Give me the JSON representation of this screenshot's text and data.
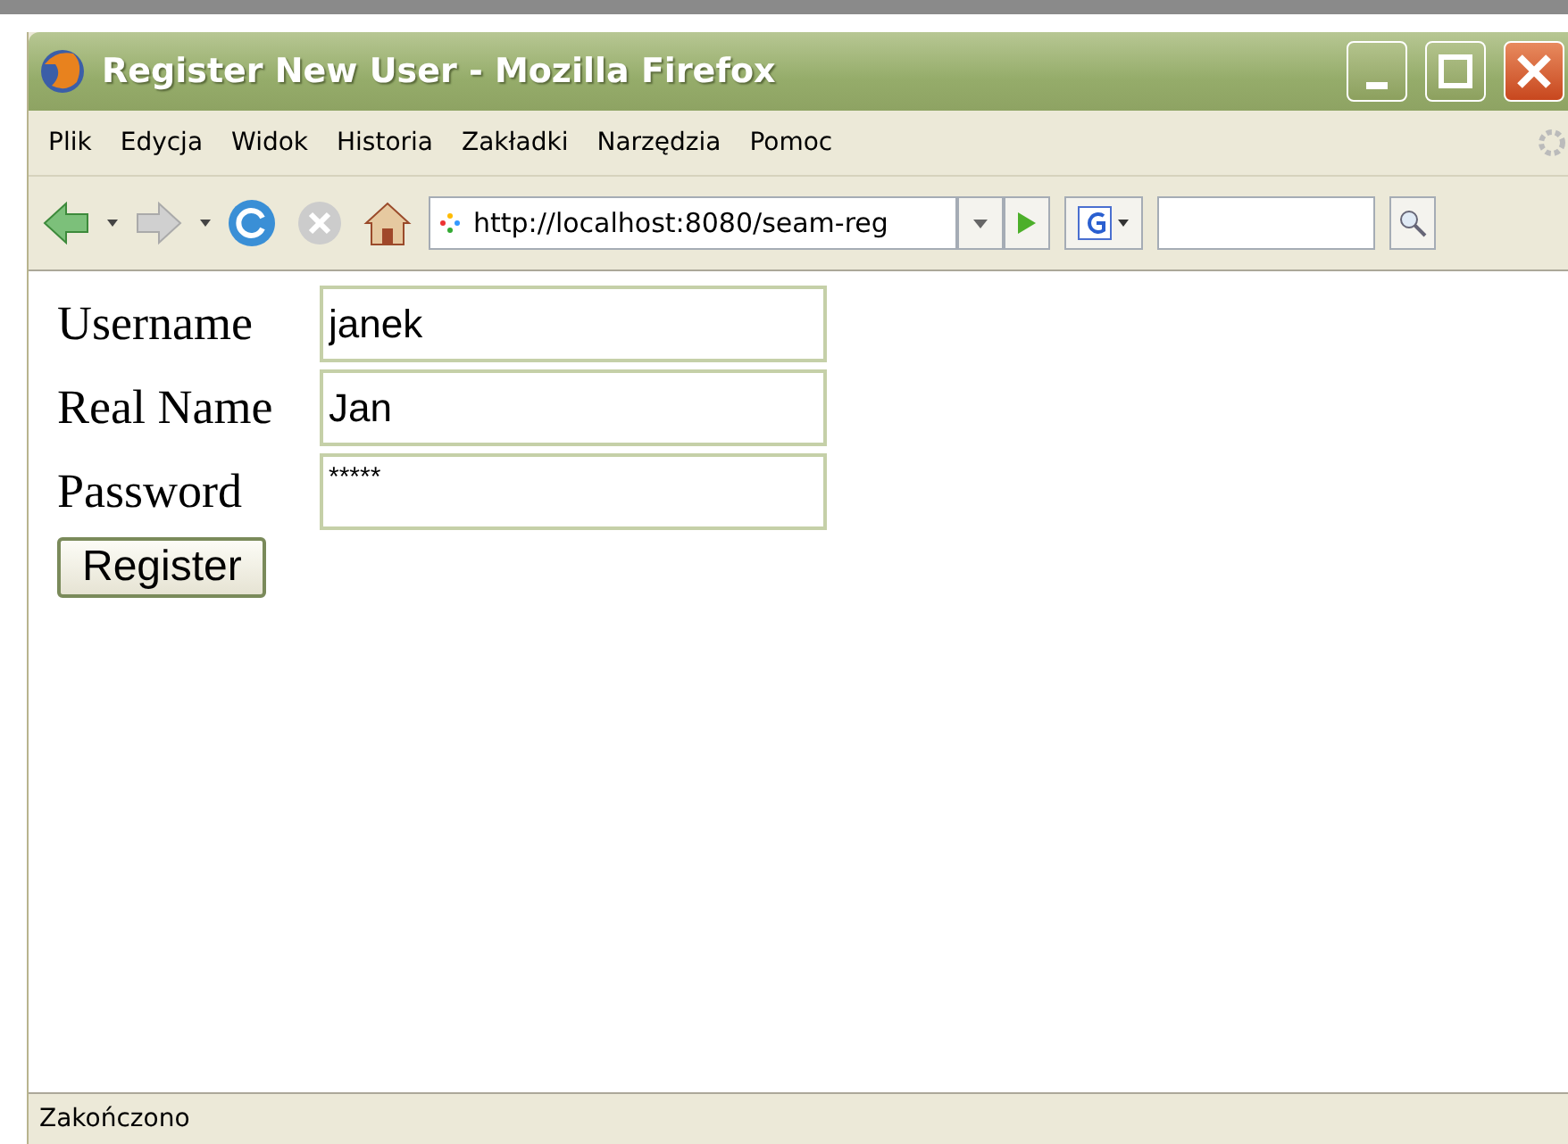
{
  "window": {
    "title": "Register New User - Mozilla Firefox"
  },
  "menu": [
    "Plik",
    "Edycja",
    "Widok",
    "Historia",
    "Zakładki",
    "Narzędzia",
    "Pomoc"
  ],
  "address_bar": {
    "value": "http://localhost:8080/seam-reg"
  },
  "form": {
    "fields": [
      {
        "label": "Username",
        "value": "janek",
        "kind": "text"
      },
      {
        "label": "Real Name",
        "value": "Jan",
        "kind": "text"
      },
      {
        "label": "Password",
        "value": "*****",
        "kind": "password"
      }
    ],
    "submit": "Register"
  },
  "status_bar": "Zakończono"
}
